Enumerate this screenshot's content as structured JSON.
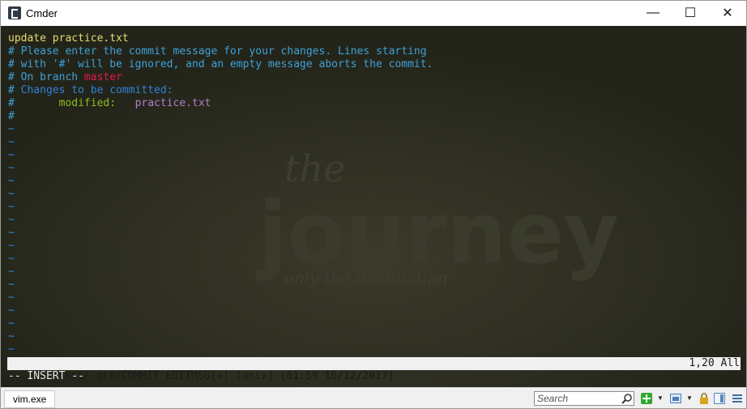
{
  "window": {
    "title": "Cmder",
    "minimize_glyph": "—",
    "maximize_glyph": "☐",
    "close_glyph": "✕"
  },
  "background": {
    "word_the": "the",
    "word_main": "journey",
    "tagline": "only the destination"
  },
  "editor": {
    "lines": [
      [
        {
          "t": "update practice.txt",
          "c": "default"
        }
      ],
      [
        {
          "t": "# Please enter the commit message for your changes. Lines starting",
          "c": "comment"
        }
      ],
      [
        {
          "t": "# with '#' will be ignored, and an empty message aborts the commit.",
          "c": "comment"
        }
      ],
      [
        {
          "t": "# On branch ",
          "c": "comment"
        },
        {
          "t": "master",
          "c": "branch"
        }
      ],
      [
        {
          "t": "# ",
          "c": "comment"
        },
        {
          "t": "Changes to be committed:",
          "c": "header"
        }
      ],
      [
        {
          "t": "#       ",
          "c": "comment"
        },
        {
          "t": "modified:",
          "c": "modified"
        },
        {
          "t": "   ",
          "c": "comment"
        },
        {
          "t": "practice.txt",
          "c": "file"
        }
      ],
      [
        {
          "t": "#",
          "c": "comment"
        }
      ],
      [
        {
          "t": "~",
          "c": "tilde"
        }
      ],
      [
        {
          "t": "~",
          "c": "tilde"
        }
      ],
      [
        {
          "t": "~",
          "c": "tilde"
        }
      ],
      [
        {
          "t": "~",
          "c": "tilde"
        }
      ],
      [
        {
          "t": "~",
          "c": "tilde"
        }
      ],
      [
        {
          "t": "~",
          "c": "tilde"
        }
      ],
      [
        {
          "t": "~",
          "c": "tilde"
        }
      ],
      [
        {
          "t": "~",
          "c": "tilde"
        }
      ],
      [
        {
          "t": "~",
          "c": "tilde"
        }
      ],
      [
        {
          "t": "~",
          "c": "tilde"
        }
      ],
      [
        {
          "t": "~",
          "c": "tilde"
        }
      ],
      [
        {
          "t": "~",
          "c": "tilde"
        }
      ],
      [
        {
          "t": "~",
          "c": "tilde"
        }
      ],
      [
        {
          "t": "~",
          "c": "tilde"
        }
      ],
      [
        {
          "t": "~",
          "c": "tilde"
        }
      ],
      [
        {
          "t": "~",
          "c": "tilde"
        }
      ],
      [
        {
          "t": "~",
          "c": "tilde"
        }
      ],
      [
        {
          "t": "~",
          "c": "tilde"
        }
      ]
    ],
    "status_left": "~/test/.git/COMMIT_EDITMSG[+] [unix] (01:59 16/12/2017)",
    "status_right": "1,20 All",
    "mode": "-- INSERT --"
  },
  "bottom_bar": {
    "console_tab": "vim.exe",
    "search_placeholder": "Search"
  },
  "colors": {
    "terminal_bg": "#292a22",
    "default_text": "#e6db74",
    "comment": "#3ea1d8",
    "branch": "#e8174a",
    "header": "#2e83d8",
    "modified": "#8fbc1a",
    "file": "#ae81c8"
  }
}
